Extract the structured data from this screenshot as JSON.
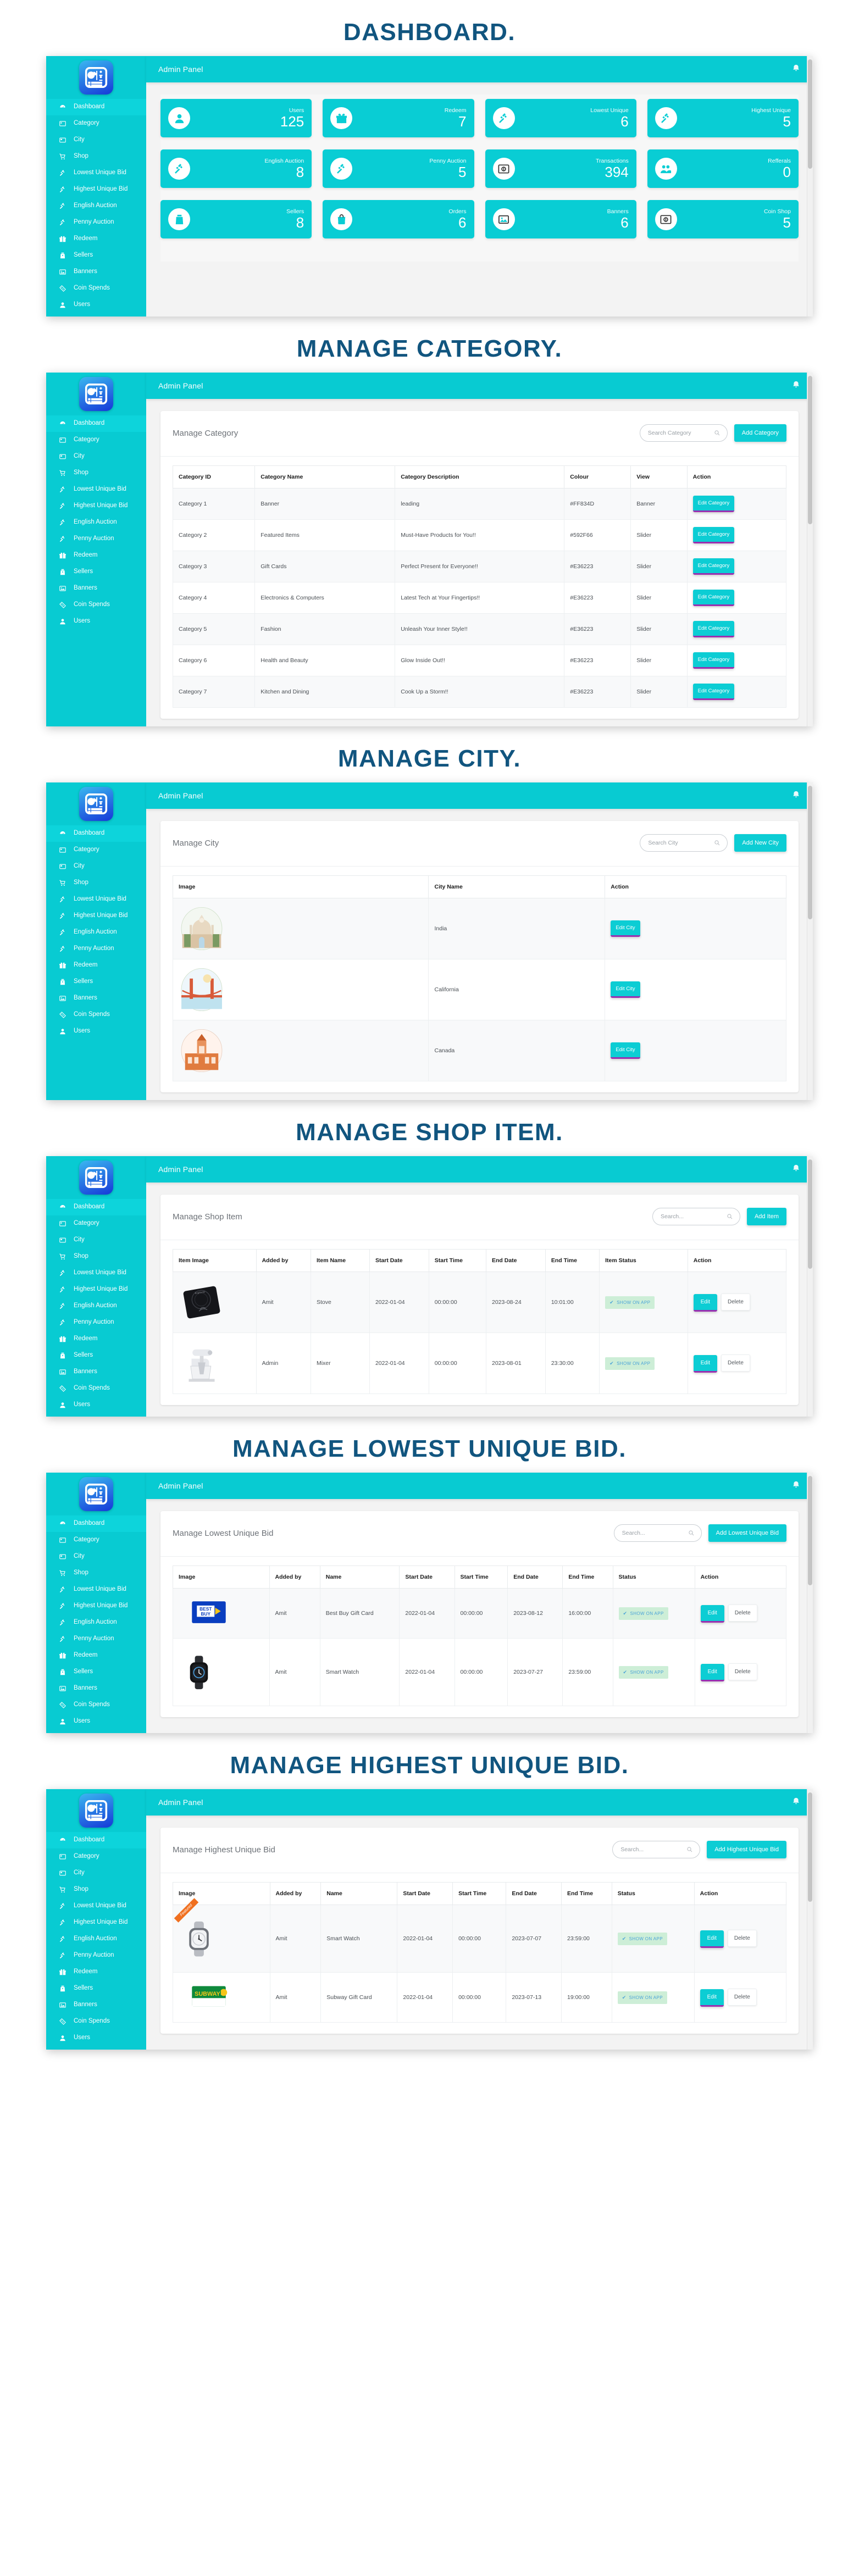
{
  "sidebar": {
    "brand_icon": "dashboard-logo-icon",
    "items": [
      {
        "label": "Dashboard",
        "icon": "speedometer-icon",
        "active": true
      },
      {
        "label": "Category",
        "icon": "list-box-icon",
        "active": false
      },
      {
        "label": "City",
        "icon": "card-icon",
        "active": false
      },
      {
        "label": "Shop",
        "icon": "cart-icon",
        "active": false
      },
      {
        "label": "Lowest Unique Bid",
        "icon": "gavel-icon",
        "active": false
      },
      {
        "label": "Highest Unique Bid",
        "icon": "gavel-icon",
        "active": false
      },
      {
        "label": "English Auction",
        "icon": "gavel-icon",
        "active": false
      },
      {
        "label": "Penny Auction",
        "icon": "gavel-icon",
        "active": false
      },
      {
        "label": "Redeem",
        "icon": "gift-icon",
        "active": false
      },
      {
        "label": "Sellers",
        "icon": "seller-icon",
        "active": false
      },
      {
        "label": "Banners",
        "icon": "image-icon",
        "active": false
      },
      {
        "label": "Coin Spends",
        "icon": "ticket-icon",
        "active": false
      },
      {
        "label": "Users",
        "icon": "user-icon",
        "active": false
      }
    ]
  },
  "topbar": {
    "title": "Admin Panel",
    "bell_icon": "bell-icon"
  },
  "sections": [
    {
      "heading": "DASHBOARD.",
      "type": "dashboard",
      "cards": [
        {
          "label": "Users",
          "value": "125",
          "icon": "user-icon"
        },
        {
          "label": "Redeem",
          "value": "7",
          "icon": "gift-icon"
        },
        {
          "label": "Lowest Unique",
          "value": "6",
          "icon": "gavel-icon"
        },
        {
          "label": "Highest Unique",
          "value": "5",
          "icon": "gavel-icon"
        },
        {
          "label": "English Auction",
          "value": "8",
          "icon": "gavel-icon"
        },
        {
          "label": "Penny Auction",
          "value": "5",
          "icon": "gavel-icon"
        },
        {
          "label": "Transactions",
          "value": "394",
          "icon": "coin-icon"
        },
        {
          "label": "Refferals",
          "value": "0",
          "icon": "group-icon"
        },
        {
          "label": "Sellers",
          "value": "8",
          "icon": "seller-icon"
        },
        {
          "label": "Orders",
          "value": "6",
          "icon": "bag-icon"
        },
        {
          "label": "Banners",
          "value": "6",
          "icon": "image-icon"
        },
        {
          "label": "Coin Shop",
          "value": "5",
          "icon": "coin-icon"
        }
      ]
    },
    {
      "heading": "MANAGE CATEGORY.",
      "type": "table",
      "panel_title": "Manage Category",
      "search_placeholder": "Search Category",
      "add_label": "Add Category",
      "columns": [
        "Category ID",
        "Category Name",
        "Category Description",
        "Colour",
        "View",
        "Action"
      ],
      "action_label": "Edit Category",
      "rows": [
        [
          "Category 1",
          "Banner",
          "leading",
          "#FF834D",
          "Banner"
        ],
        [
          "Category 2",
          "Featured Items",
          "Must-Have Products for You!!",
          "#592F66",
          "Slider"
        ],
        [
          "Category 3",
          "Gift Cards",
          "Perfect Present for Everyone!!",
          "#E36223",
          "Slider"
        ],
        [
          "Category 4",
          "Electronics & Computers",
          "Latest Tech at Your Fingertips!!",
          "#E36223",
          "Slider"
        ],
        [
          "Category 5",
          "Fashion",
          "Unleash Your Inner Style!!",
          "#E36223",
          "Slider"
        ],
        [
          "Category 6",
          "Health and Beauty",
          "Glow Inside Out!!",
          "#E36223",
          "Slider"
        ],
        [
          "Category 7",
          "Kitchen and Dining",
          "Cook Up a Storm!!",
          "#E36223",
          "Slider"
        ]
      ]
    },
    {
      "heading": "MANAGE CITY.",
      "type": "city",
      "panel_title": "Manage City",
      "search_placeholder": "Search City",
      "add_label": "Add New City",
      "columns": [
        "Image",
        "City Name",
        "Action"
      ],
      "action_label": "Edit City",
      "rows": [
        {
          "image": "taj-mahal-thumb",
          "name": "India"
        },
        {
          "image": "golden-gate-thumb",
          "name": "California"
        },
        {
          "image": "parliament-thumb",
          "name": "Canada"
        }
      ]
    },
    {
      "heading": "MANAGE SHOP ITEM.",
      "type": "items",
      "panel_title": "Manage Shop Item",
      "search_placeholder": "Search...",
      "add_label": "Add Item",
      "columns": [
        "Item Image",
        "Added by",
        "Item Name",
        "Start Date",
        "Start Time",
        "End Date",
        "End Time",
        "Item Status",
        "Action"
      ],
      "status_label": "SHOW ON APP",
      "edit_label": "Edit",
      "delete_label": "Delete",
      "rows": [
        {
          "image": "induction-cooktop-thumb",
          "added_by": "Amit",
          "name": "Stove",
          "start_date": "2022-01-04",
          "start_time": "00:00:00",
          "end_date": "2023-08-24",
          "end_time": "10:01:00"
        },
        {
          "image": "stand-mixer-thumb",
          "added_by": "Admin",
          "name": "Mixer",
          "start_date": "2022-01-04",
          "start_time": "00:00:00",
          "end_date": "2023-08-01",
          "end_time": "23:30:00"
        }
      ]
    },
    {
      "heading": "MANAGE LOWEST UNIQUE BID.",
      "type": "items",
      "panel_title": "Manage Lowest Unique Bid",
      "search_placeholder": "Search...",
      "add_label": "Add Lowest Unique Bid",
      "columns": [
        "Image",
        "Added by",
        "Name",
        "Start Date",
        "Start Time",
        "End Date",
        "End Time",
        "Status",
        "Action"
      ],
      "status_label": "SHOW ON APP",
      "edit_label": "Edit",
      "delete_label": "Delete",
      "rows": [
        {
          "image": "bestbuy-giftcard-thumb",
          "added_by": "Amit",
          "name": "Best Buy Gift Card",
          "start_date": "2022-01-04",
          "start_time": "00:00:00",
          "end_date": "2023-08-12",
          "end_time": "16:00:00"
        },
        {
          "image": "smartwatch-black-thumb",
          "added_by": "Amit",
          "name": "Smart Watch",
          "start_date": "2022-01-04",
          "start_time": "00:00:00",
          "end_date": "2023-07-27",
          "end_time": "23:59:00"
        }
      ]
    },
    {
      "heading": "MANAGE HIGHEST UNIQUE BID.",
      "type": "items",
      "panel_title": "Manage Highest Unique Bid",
      "search_placeholder": "Search...",
      "add_label": "Add Highest Unique Bid",
      "columns": [
        "Image",
        "Added by",
        "Name",
        "Start Date",
        "Start Time",
        "End Date",
        "End Time",
        "Status",
        "Action"
      ],
      "status_label": "SHOW ON APP",
      "edit_label": "Edit",
      "delete_label": "Delete",
      "featured_ribbon": "Featured",
      "rows": [
        {
          "image": "smartwatch-silver-thumb",
          "added_by": "Amit",
          "name": "Smart Watch",
          "start_date": "2022-01-04",
          "start_time": "00:00:00",
          "end_date": "2023-07-07",
          "end_time": "23:59:00",
          "ribbon": true
        },
        {
          "image": "subway-giftcard-thumb",
          "added_by": "Amit",
          "name": "Subway Gift Card",
          "start_date": "2022-01-04",
          "start_time": "00:00:00",
          "end_date": "2023-07-13",
          "end_time": "19:00:00",
          "ribbon": false
        }
      ]
    }
  ],
  "colors": {
    "accent": "#08cbd2",
    "heading": "#11557f",
    "edit_underline": "#9b2fb0",
    "status_chip_bg": "#cdeed7"
  }
}
